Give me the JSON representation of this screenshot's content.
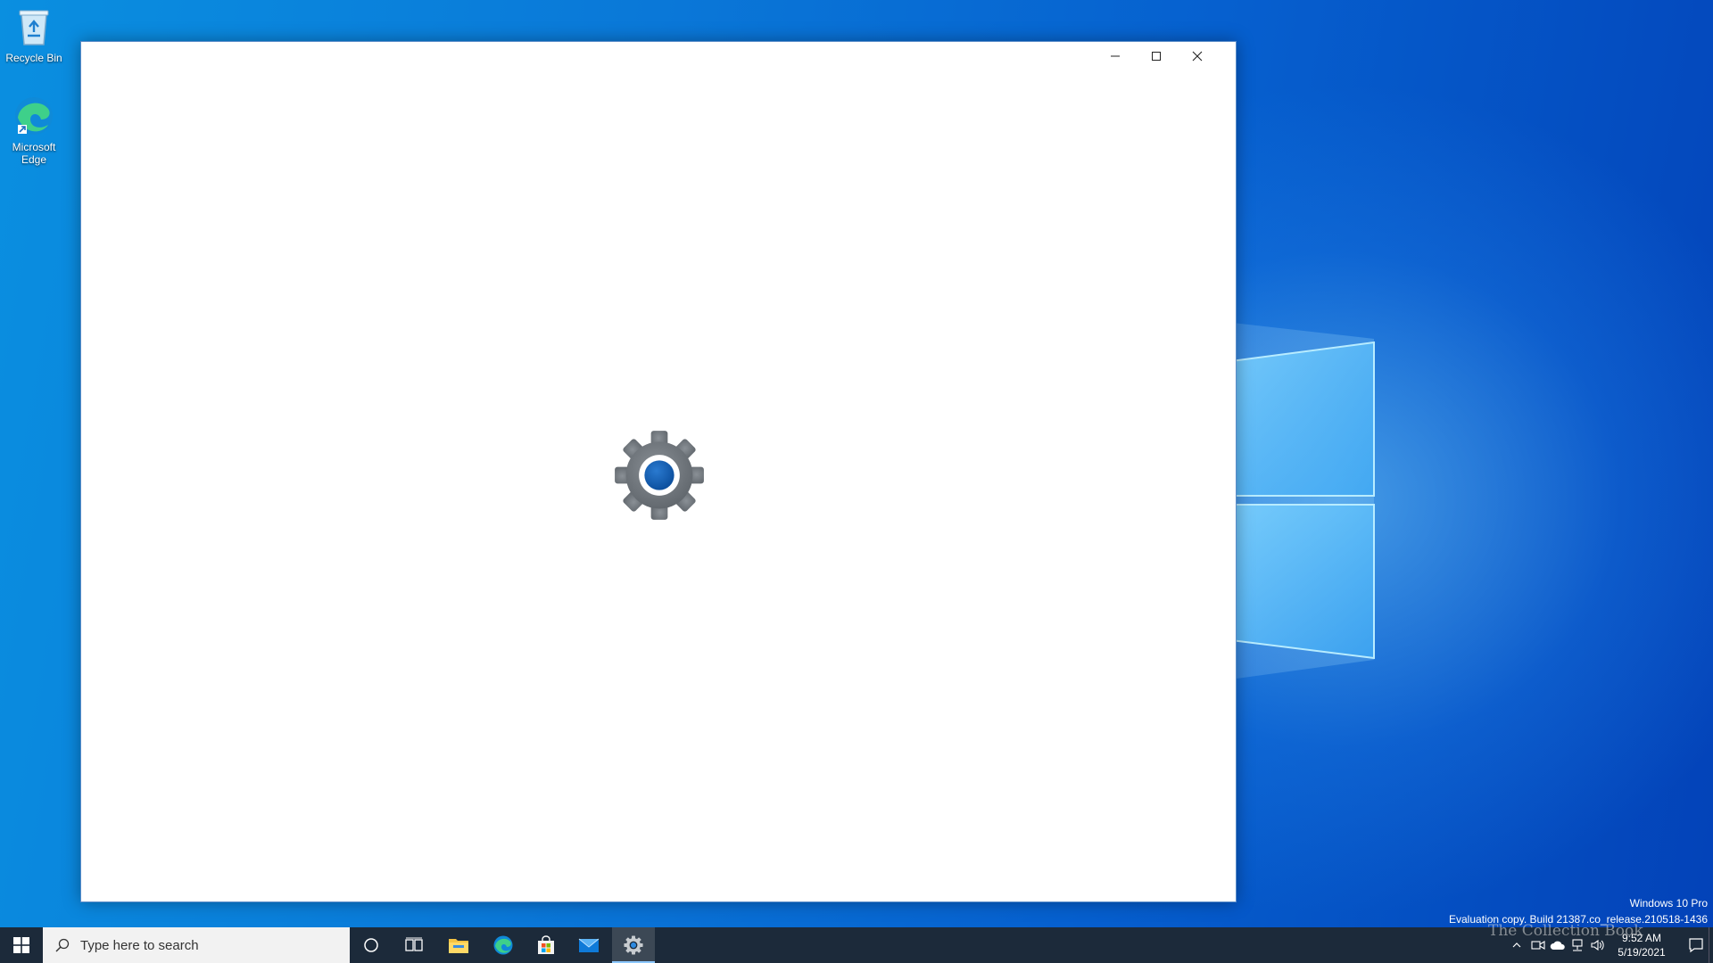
{
  "desktop": {
    "icons": [
      {
        "label": "Recycle Bin",
        "icon": "recycle-bin-icon"
      },
      {
        "label": "Microsoft Edge",
        "icon": "edge-icon"
      }
    ],
    "watermark": {
      "edition": "Windows 10 Pro",
      "build": "Evaluation copy. Build 21387.co_release.210518-1436"
    },
    "corner_watermark": "The Collection Book"
  },
  "window": {
    "splash_icon": "settings-gear-icon",
    "caption_buttons": {
      "minimize": "minimize-icon",
      "maximize": "maximize-icon",
      "close": "close-icon"
    }
  },
  "taskbar": {
    "search_placeholder": "Type here to search",
    "pinned": [
      {
        "name": "cortana",
        "icon": "cortana-circle-icon"
      },
      {
        "name": "task-view",
        "icon": "task-view-icon"
      },
      {
        "name": "file-explorer",
        "icon": "folder-icon"
      },
      {
        "name": "edge",
        "icon": "edge-icon"
      },
      {
        "name": "store",
        "icon": "store-bag-icon"
      },
      {
        "name": "mail",
        "icon": "mail-icon"
      },
      {
        "name": "settings",
        "icon": "gear-icon",
        "active": true
      }
    ],
    "clock": {
      "time": "9:52 AM",
      "date": "5/19/2021"
    }
  },
  "colors": {
    "accent": "#0063b1",
    "taskbar": "#1c2a3a",
    "gear": "#6d7378"
  }
}
